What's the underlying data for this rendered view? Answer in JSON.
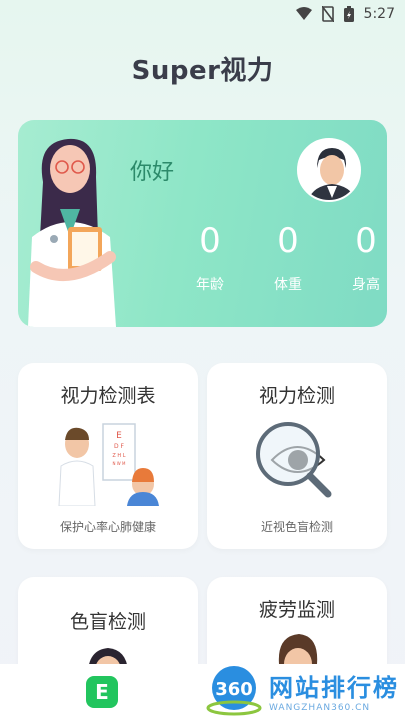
{
  "status_bar": {
    "time": "5:27"
  },
  "header": {
    "title": "Super视力"
  },
  "hero": {
    "greeting": "你好",
    "stats": [
      {
        "value": "0",
        "label": "年龄"
      },
      {
        "value": "0",
        "label": "体重"
      },
      {
        "value": "0",
        "label": "身高"
      }
    ]
  },
  "features": [
    {
      "title": "视力检测表",
      "subtitle": "保护心率心肺健康",
      "icon": "eye-chart-icon"
    },
    {
      "title": "视力检测",
      "subtitle": "近视色盲检测",
      "icon": "magnifier-eye-icon"
    },
    {
      "title": "色盲检测",
      "subtitle": "",
      "icon": "person-icon"
    },
    {
      "title": "疲劳监测",
      "subtitle": "",
      "icon": "tired-person-icon"
    }
  ],
  "bottom_nav": {
    "e_label": "E"
  },
  "watermark": {
    "logo_text": "360",
    "main": "网站排行榜",
    "sub": "WANGZHAN360.CN"
  },
  "colors": {
    "accent": "#8ee6c7",
    "greeting": "#2c8a6a",
    "nav_green": "#22c55e",
    "watermark_blue": "#2a8ee0"
  }
}
